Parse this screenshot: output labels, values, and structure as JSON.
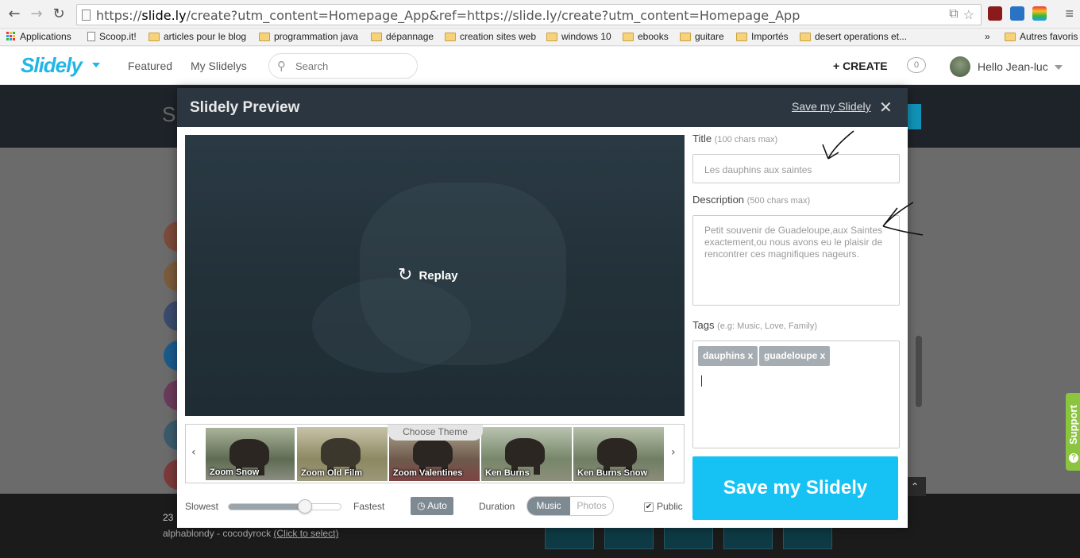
{
  "browser": {
    "url_prefix": "https://",
    "url_host": "slide.ly",
    "url_rest": "/create?utm_content=Homepage_App&ref=https://slide.ly/create?utm_content=Homepage_App",
    "menu_icon": "hamburger-icon"
  },
  "bookmarks": {
    "apps": "Applications",
    "items": [
      "Scoop.it!",
      "articles pour le blog",
      "programmation java",
      "dépannage",
      "creation sites web",
      "windows 10",
      "ebooks",
      "guitare",
      "Importés",
      "desert operations et..."
    ],
    "overflow": "»",
    "other": "Autres favoris"
  },
  "header": {
    "logo": "Slidely",
    "nav": [
      "Featured",
      "My Slidelys"
    ],
    "search_placeholder": "Search",
    "create": "+ CREATE",
    "notifications": "0",
    "greeting": "Hello Jean-luc",
    "accent": "#21b6e6"
  },
  "background": {
    "title_ghost": "S",
    "count": "23",
    "track": "alphablondy - cocodyrock",
    "select_link": "(Click to select)",
    "support": "Support"
  },
  "modal": {
    "title": "Slidely Preview",
    "save_link": "Save my Slidely",
    "close": "✕",
    "replay": "Replay",
    "choose_theme": "Choose Theme",
    "themes": [
      "Zoom Snow",
      "Zoom Old Film",
      "Zoom Valentines",
      "Ken Burns",
      "Ken Burns Snow"
    ],
    "controls": {
      "slowest": "Slowest",
      "fastest": "Fastest",
      "speed_level": 0.68,
      "auto": "Auto",
      "duration": "Duration",
      "music": "Music",
      "photos": "Photos",
      "public": "Public",
      "public_checked": "✔"
    },
    "form": {
      "title_label": "Title",
      "title_hint": "(100 chars max)",
      "title_value": "Les dauphins aux saintes",
      "description_label": "Description",
      "description_hint": "(500 chars max)",
      "description_value": "Petit souvenir de Guadeloupe,aux Saintes exactement,ou nous avons eu le plaisir de rencontrer ces magnifiques nageurs.",
      "tags_label": "Tags",
      "tags_hint": "(e.g: Music, Love, Family)",
      "tags": [
        "dauphins x",
        "guadeloupe x"
      ],
      "save_button": "Save my Slidely",
      "save_color": "#15c2f3"
    }
  }
}
